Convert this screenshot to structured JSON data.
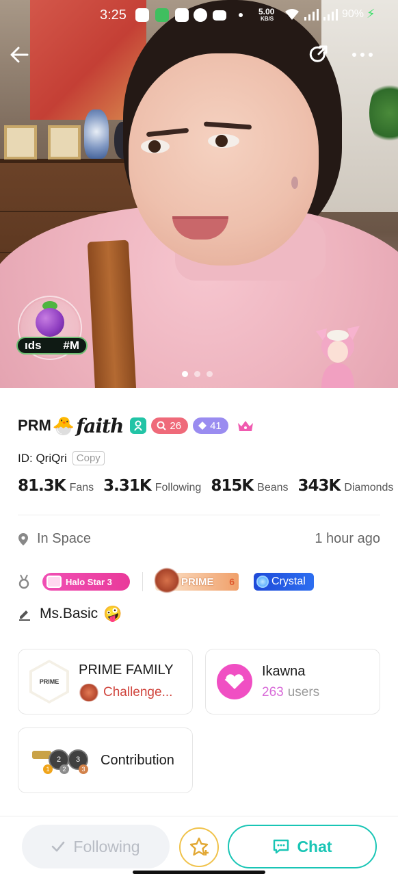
{
  "status_bar": {
    "time": "3:25",
    "net_speed_value": "5.00",
    "net_speed_unit": "KB/S",
    "battery": "90%"
  },
  "hero": {
    "badge_tag_left": "ıds",
    "badge_tag_right": "#M",
    "carousel_pages": 3,
    "carousel_active_index": 0
  },
  "profile": {
    "name_prefix": "PRM",
    "name_emoji": "🐣",
    "name_script": "faith",
    "level_red": "26",
    "level_purple": "41",
    "id_label": "ID: QriQri",
    "copy_label": "Copy",
    "stats": [
      {
        "value": "81.3K",
        "label": "Fans"
      },
      {
        "value": "3.31K",
        "label": "Following"
      },
      {
        "value": "815K",
        "label": "Beans"
      },
      {
        "value": "343K",
        "label": "Diamonds"
      }
    ],
    "location": "In Space",
    "last_active": "1 hour ago",
    "medals": {
      "halo_star": "Halo Star 3",
      "prime_label": "PRIME",
      "prime_level": "6",
      "crystal": "Crystal"
    },
    "bio": "Ms.Basic",
    "bio_emoji": "🤪"
  },
  "cards": {
    "family_title": "PRIME FAMILY",
    "family_sub": "Challenge...",
    "family_logo_text": "PRIME",
    "group_title": "Ikawna",
    "group_count": "263",
    "group_count_unit": "users",
    "contribution_title": "Contribution"
  },
  "bottom_bar": {
    "following_label": "Following",
    "chat_label": "Chat"
  },
  "colors": {
    "accent_teal": "#19c5b5",
    "pink": "#f04fc3",
    "level_red": "#ef6a7a",
    "level_purple": "#9a8cf0"
  }
}
